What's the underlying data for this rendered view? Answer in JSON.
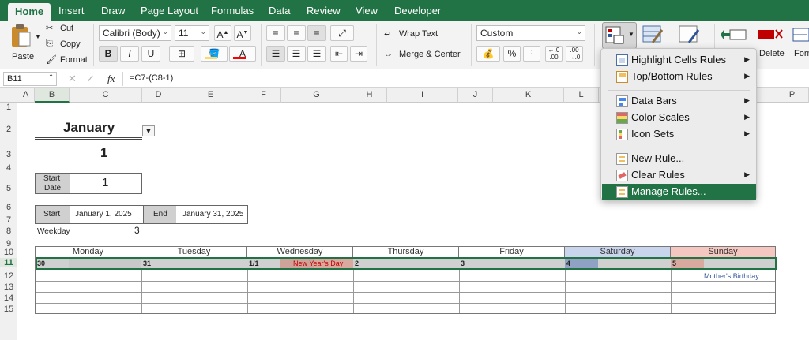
{
  "tabs": [
    "Home",
    "Insert",
    "Draw",
    "Page Layout",
    "Formulas",
    "Data",
    "Review",
    "View",
    "Developer"
  ],
  "ribbon": {
    "paste": "Paste",
    "cut": "Cut",
    "copy": "Copy",
    "format": "Format",
    "font_name": "Calibri (Body)",
    "font_size": "11",
    "bold": "B",
    "italic": "I",
    "underline": "U",
    "wrap_text": "Wrap Text",
    "merge_center": "Merge & Center",
    "number_format": "Custom",
    "percent": "%",
    "comma": "⁾",
    "delete": "Delete",
    "format_short": "Form",
    "fill_color": "#FFD966",
    "font_color": "#FF0000"
  },
  "formula_bar": {
    "name_box": "B11",
    "fx": "fx",
    "formula": "=C7-(C8-1)"
  },
  "columns": [
    "A",
    "B",
    "C",
    "D",
    "E",
    "F",
    "G",
    "H",
    "I",
    "J",
    "K",
    "L",
    "P"
  ],
  "rows": [
    "1",
    "2",
    "3",
    "4",
    "5",
    "6",
    "7",
    "8",
    "9",
    "10",
    "11",
    "12",
    "13",
    "14",
    "15"
  ],
  "sheet": {
    "month": "January",
    "month_num": "1",
    "start_label_1": "Start",
    "start_label_2": "Date",
    "start_value": "1",
    "start": "Start",
    "start_date": "January 1, 2025",
    "end": "End",
    "end_date": "January 31, 2025",
    "weekday": "Weekday",
    "weekday_value": "3",
    "days": [
      "Monday",
      "Tuesday",
      "Wednesday",
      "Thursday",
      "Friday",
      "Saturday",
      "Sunday"
    ],
    "week": [
      "30",
      "31",
      "1/1",
      "2",
      "3",
      "4",
      "5"
    ],
    "holiday": "New Year's Day",
    "birthday": "Mother's Birthday"
  },
  "menu": {
    "items": [
      {
        "label": "Highlight Cells Rules",
        "submenu": true
      },
      {
        "label": "Top/Bottom Rules",
        "submenu": true
      },
      {
        "label": "Data Bars",
        "submenu": true
      },
      {
        "label": "Color Scales",
        "submenu": true
      },
      {
        "label": "Icon Sets",
        "submenu": true
      },
      {
        "label": "New Rule...",
        "submenu": false
      },
      {
        "label": "Clear Rules",
        "submenu": true
      },
      {
        "label": "Manage Rules...",
        "submenu": false
      }
    ],
    "arrow": "▶"
  },
  "colors": {
    "accent": "#217346",
    "saturday": "#c9d5ec",
    "sunday": "#f4c7c1",
    "holiday_text": "#c00000",
    "birthday_text": "#2f5597"
  }
}
